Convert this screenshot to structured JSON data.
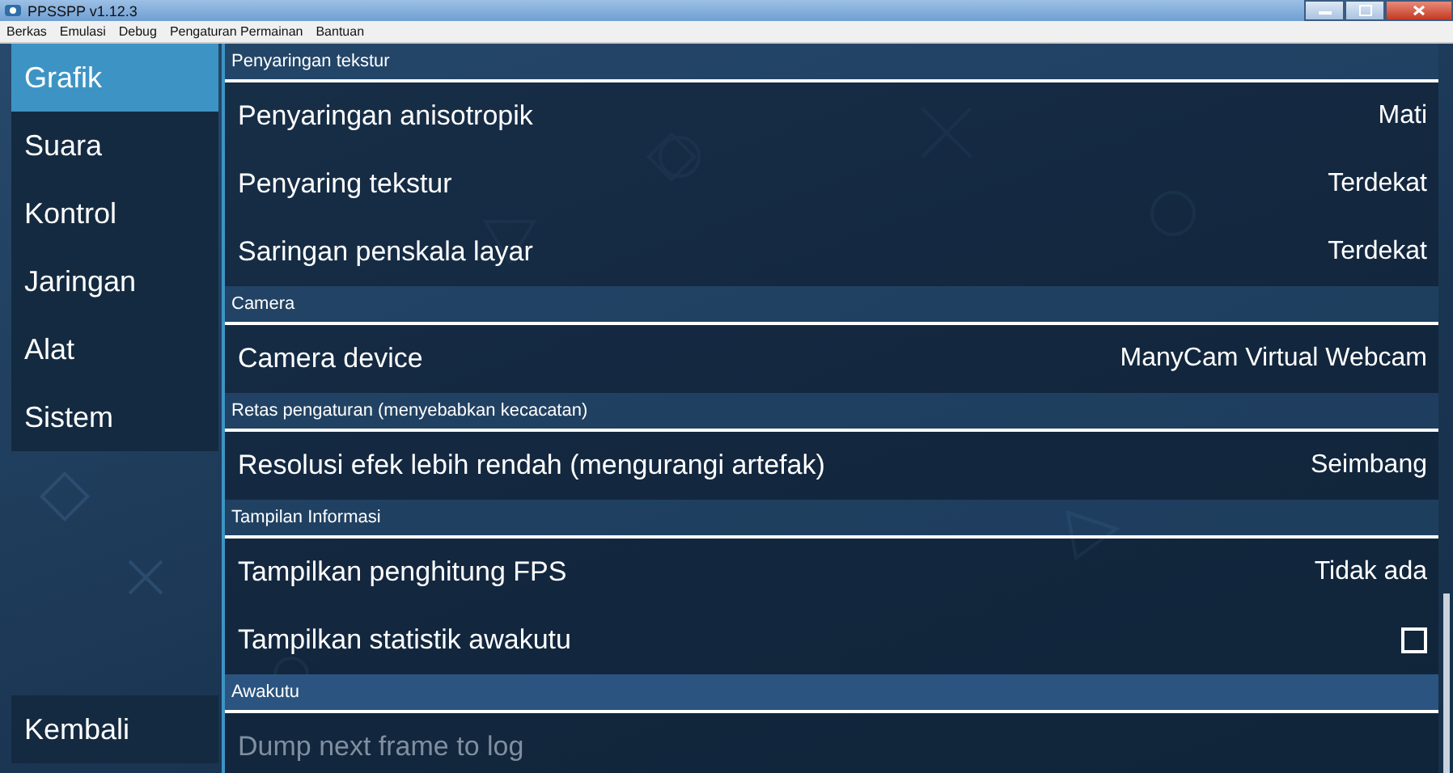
{
  "window": {
    "title": "PPSSPP v1.12.3"
  },
  "menu": [
    "Berkas",
    "Emulasi",
    "Debug",
    "Pengaturan Permainan",
    "Bantuan"
  ],
  "sidebar": {
    "items": [
      {
        "label": "Grafik",
        "selected": true
      },
      {
        "label": "Suara",
        "selected": false
      },
      {
        "label": "Kontrol",
        "selected": false
      },
      {
        "label": "Jaringan",
        "selected": false
      },
      {
        "label": "Alat",
        "selected": false
      },
      {
        "label": "Sistem",
        "selected": false
      }
    ],
    "back_button": "Kembali"
  },
  "settings": [
    {
      "kind": "header",
      "label": "Penyaringan tekstur",
      "focused": false
    },
    {
      "kind": "choice",
      "label": "Penyaringan anisotropik",
      "value": "Mati",
      "disabled": false
    },
    {
      "kind": "choice",
      "label": "Penyaring tekstur",
      "value": "Terdekat",
      "disabled": false
    },
    {
      "kind": "choice",
      "label": "Saringan penskala layar",
      "value": "Terdekat",
      "disabled": false
    },
    {
      "kind": "header",
      "label": "Camera",
      "focused": false
    },
    {
      "kind": "choice",
      "label": "Camera device",
      "value": "ManyCam Virtual Webcam",
      "disabled": false
    },
    {
      "kind": "header",
      "label": "Retas pengaturan (menyebabkan kecacatan)",
      "focused": false
    },
    {
      "kind": "choice",
      "label": "Resolusi efek lebih rendah (mengurangi artefak)",
      "value": "Seimbang",
      "disabled": false
    },
    {
      "kind": "header",
      "label": "Tampilan Informasi",
      "focused": false
    },
    {
      "kind": "choice",
      "label": "Tampilkan penghitung FPS",
      "value": "Tidak ada",
      "disabled": false
    },
    {
      "kind": "checkbox",
      "label": "Tampilkan statistik awakutu",
      "checked": false,
      "disabled": false
    },
    {
      "kind": "header",
      "label": "Awakutu",
      "focused": true
    },
    {
      "kind": "action",
      "label": "Dump next frame to log",
      "disabled": true
    }
  ]
}
